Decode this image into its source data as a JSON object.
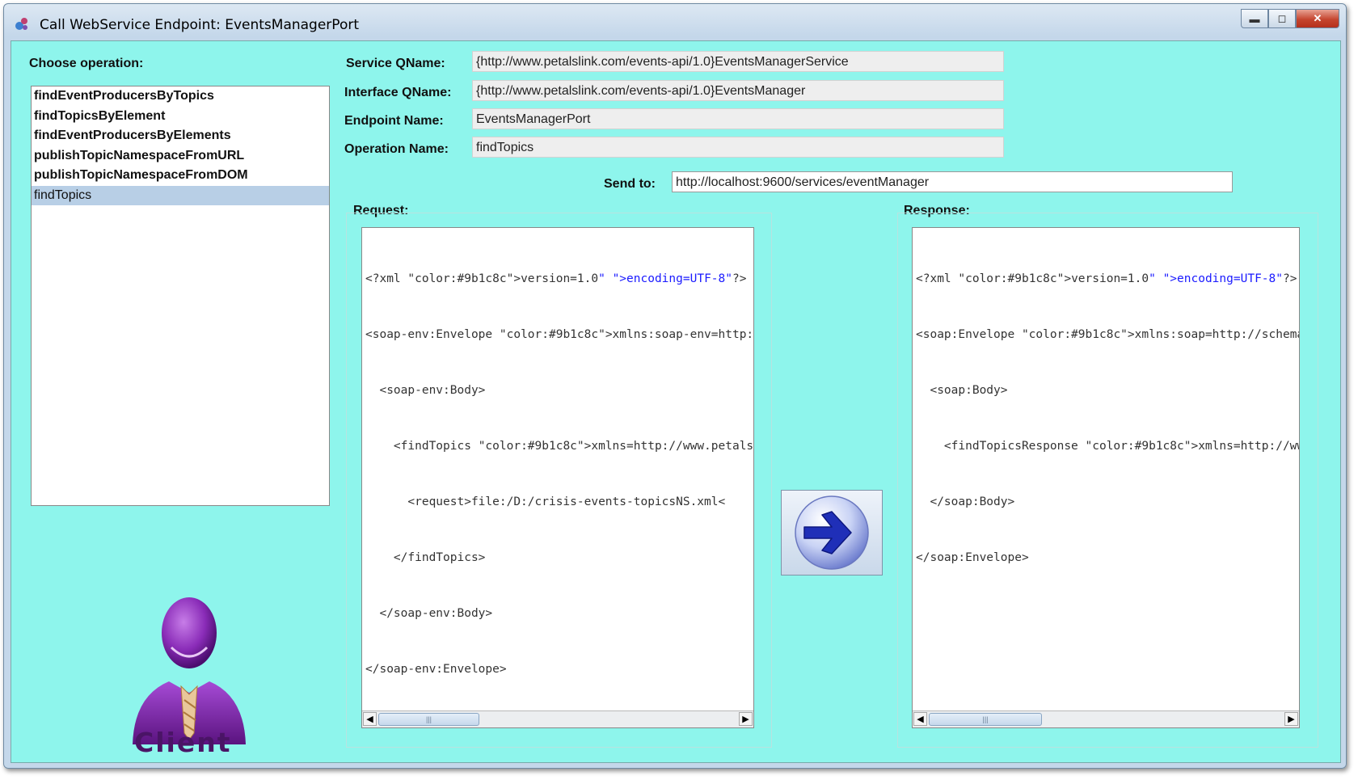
{
  "window": {
    "title": "Call WebService Endpoint: EventsManagerPort",
    "controls": [
      "minimize",
      "maximize",
      "close"
    ]
  },
  "operations": {
    "label": "Choose operation:",
    "items": [
      "findEventProducersByTopics",
      "findTopicsByElement",
      "findEventProducersByElements",
      "publishTopicNamespaceFromURL",
      "publishTopicNamespaceFromDOM",
      "findTopics"
    ],
    "selected": "findTopics"
  },
  "fields": {
    "service_qname_label": "Service QName:",
    "service_qname": "{http://www.petalslink.com/events-api/1.0}EventsManagerService",
    "interface_qname_label": "Interface QName:",
    "interface_qname": "{http://www.petalslink.com/events-api/1.0}EventsManager",
    "endpoint_name_label": "Endpoint Name:",
    "endpoint_name": "EventsManagerPort",
    "operation_name_label": "Operation Name:",
    "operation_name": "findTopics",
    "send_to_label": "Send to:",
    "send_to": "http://localhost:9600/services/eventManager"
  },
  "request": {
    "label": "Request:",
    "lines": [
      "<?xml version=\"1.0\" encoding=\"UTF-8\"?>",
      "<soap-env:Envelope xmlns:soap-env=\"http://schemas.x",
      "  <soap-env:Body>",
      "    <findTopics xmlns=\"http://www.petalslink.com/ev",
      "      <request>file:/D:/crisis-events-topicsNS.xml<",
      "    </findTopics>",
      "  </soap-env:Body>",
      "</soap-env:Envelope>"
    ]
  },
  "response": {
    "label": "Response:",
    "lines": [
      "<?xml version=\"1.0\" encoding=\"UTF-8\"?>",
      "<soap:Envelope xmlns:soap=\"http://schemas.xmlsoap.",
      "  <soap:Body>",
      "    <findTopicsResponse xmlns=\"http://www.petalsli",
      "  </soap:Body>",
      "</soap:Envelope>"
    ]
  },
  "send_button": {
    "icon": "right-arrow-icon"
  },
  "client": {
    "label": "Client",
    "icon": "client-person-icon"
  },
  "colors": {
    "background": "#8ef5ec",
    "selection": "#b8cfe6",
    "xml_tag": "#333333",
    "xml_attr": "#9b1c8c",
    "xml_value": "#1a1aff",
    "client_purple": "#6b1d8f"
  }
}
